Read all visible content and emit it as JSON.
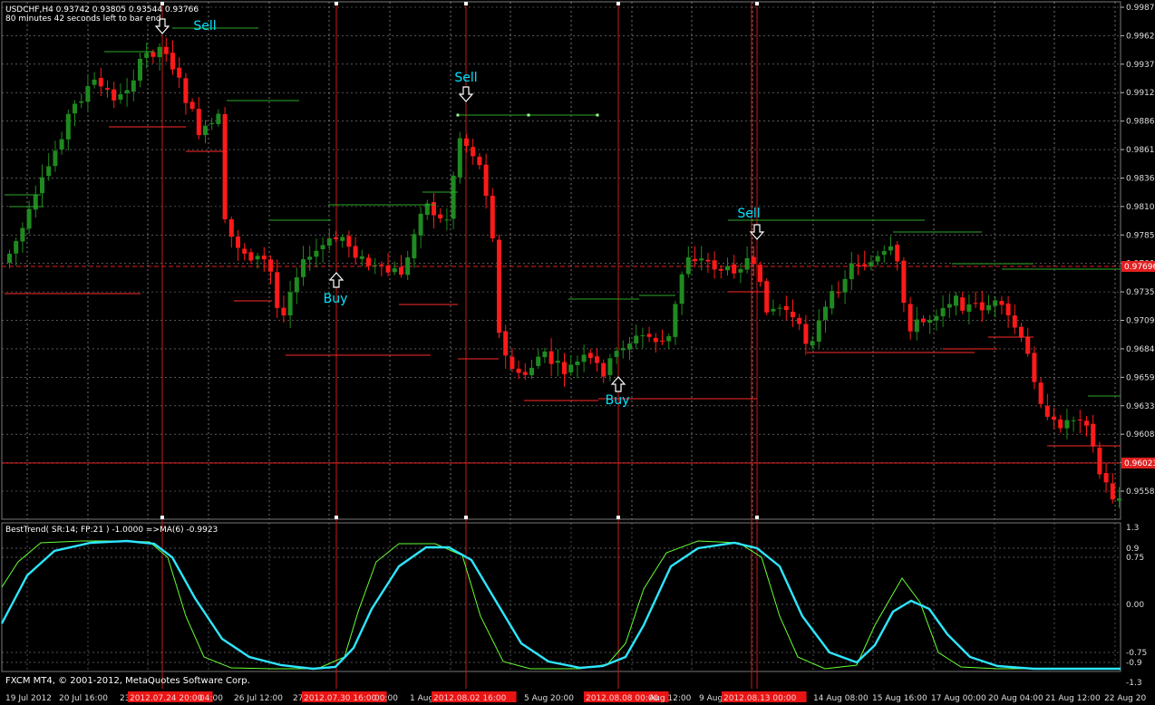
{
  "window": {
    "symbol_line": "USDCHF,H4  0.93742 0.93805 0.93544 0.93766",
    "countdown": "80 minutes 42 seconds left to bar end"
  },
  "indicator": {
    "label": "BestTrend( SR:14; FP:21 ) -1.0000  =>MA(6) -0.9923",
    "scale_labels": [
      "1.3",
      "0.9",
      "0.75",
      "0.00",
      "-0.75",
      "-0.9",
      "-1.3"
    ]
  },
  "footer": {
    "copyright": "FXCM MT4, © 2001-2012, MetaQuotes Software Corp."
  },
  "price_axis": {
    "labels": [
      "0.99875",
      "0.99625",
      "0.99370",
      "0.99120",
      "0.98865",
      "0.98610",
      "0.98360",
      "0.98105",
      "0.97855",
      "0.97600",
      "0.97350",
      "0.97095",
      "0.96840",
      "0.96590",
      "0.96335",
      "0.96085",
      "0.95830",
      "0.95580"
    ],
    "markers": [
      {
        "text": "0.97696",
        "color": "#e02020"
      },
      {
        "text": "0.96023",
        "color": "#e02020"
      }
    ]
  },
  "time_axis": {
    "labels": [
      {
        "text": "19 Jul 2012",
        "highlight": false
      },
      {
        "text": "20 Jul 16:00",
        "highlight": false
      },
      {
        "text": "23",
        "highlight": false
      },
      {
        "text": "2012.07.24 20:00",
        "highlight": true
      },
      {
        "text": "04:00",
        "highlight": false
      },
      {
        "text": "26 Jul 12:00",
        "highlight": false
      },
      {
        "text": "27",
        "highlight": false
      },
      {
        "text": "2012.07.30 16:00",
        "highlight": true
      },
      {
        "text": "00:00",
        "highlight": false
      },
      {
        "text": "1 Aug",
        "highlight": false
      },
      {
        "text": "2012.08.02 16:00",
        "highlight": true
      },
      {
        "text": "5 Aug 20:00",
        "highlight": false
      },
      {
        "text": "2012.08.08 00:00",
        "highlight": true
      },
      {
        "text": "Aug 12:00",
        "highlight": false
      },
      {
        "text": "9 Aug",
        "highlight": false
      },
      {
        "text": "2012.08.13 00:00",
        "highlight": true
      },
      {
        "text": "14 Aug 08:00",
        "highlight": false
      },
      {
        "text": "15 Aug 16:00",
        "highlight": false
      },
      {
        "text": "17 Aug 00:00",
        "highlight": false
      },
      {
        "text": "20 Aug 04:00",
        "highlight": false
      },
      {
        "text": "21 Aug 12:00",
        "highlight": false
      },
      {
        "text": "22 Aug 20",
        "highlight": false
      }
    ]
  },
  "signals": [
    {
      "type": "sell",
      "label": "Sell"
    },
    {
      "type": "buy",
      "label": "Buy"
    },
    {
      "type": "sell",
      "label": "Sell"
    },
    {
      "type": "buy",
      "label": "Buy"
    },
    {
      "type": "sell",
      "label": "Sell"
    }
  ],
  "colors": {
    "background": "#000000",
    "bull": "#1f8a1f",
    "bear": "#ff1a1a",
    "grid": "#8a8a8a",
    "signal_text": "#00e5ff",
    "indicator_main": "#2ee6ff",
    "indicator_ma": "#66ff33",
    "level_up": "#2aa82a",
    "level_down": "#ff2a2a"
  }
}
